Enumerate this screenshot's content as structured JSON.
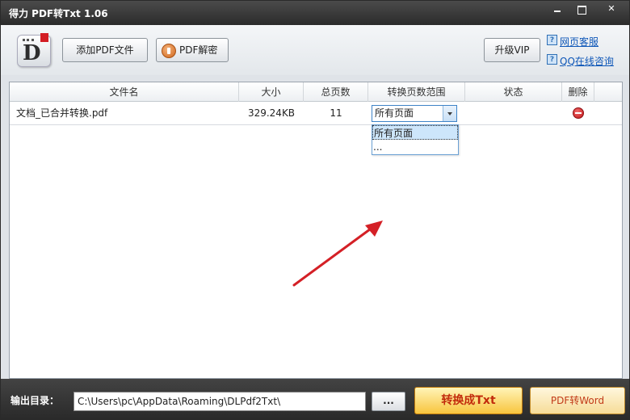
{
  "window": {
    "title": "得力 PDF转Txt 1.06",
    "min_label": "",
    "max_label": "",
    "close_label": "✕"
  },
  "toolbar": {
    "logo_letter": "D",
    "add_pdf": "添加PDF文件",
    "decrypt_pdf": "PDF解密",
    "upgrade_vip": "升级VIP",
    "support_links": [
      {
        "icon": "?",
        "label": "网页客服"
      },
      {
        "icon": "?",
        "label": "QQ在线咨询"
      }
    ]
  },
  "table": {
    "columns": [
      "文件名",
      "大小",
      "总页数",
      "转换页数范围",
      "状态",
      "删除"
    ],
    "rows": [
      {
        "name": "文档_已合并转换.pdf",
        "size": "329.24KB",
        "pages": "11",
        "range": "所有页面",
        "status": ""
      }
    ],
    "range_options": [
      "所有页面",
      "..."
    ]
  },
  "annotation": {
    "arrow_color": "#d42026"
  },
  "bottom": {
    "output_label": "输出目录：",
    "output_path": "C:\\Users\\pc\\AppData\\Roaming\\DLPdf2Txt\\",
    "browse": "...",
    "convert": "转换成Txt",
    "to_word": "PDF转Word"
  },
  "colors": {
    "titlebar": "#2b2b2b",
    "link": "#0f57b8",
    "convert_text": "#c22b0c",
    "selection": "#cde6fb"
  }
}
